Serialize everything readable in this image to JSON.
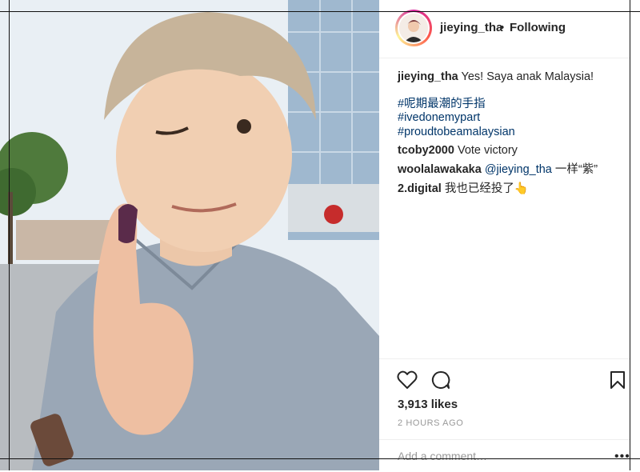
{
  "header": {
    "username": "jieying_tha",
    "separator": "•",
    "follow_status": "Following"
  },
  "caption": {
    "username": "jieying_tha",
    "text": "Yes! Saya anak Malaysia!",
    "hashtags": [
      "#呢期最潮的手指",
      "#ivedonemypart",
      "#proudtobeamalaysian"
    ]
  },
  "comments": [
    {
      "username": "tcoby2000",
      "text": "Vote victory"
    },
    {
      "username": "woolalawakaka",
      "mention": "@jieying_tha",
      "text": "一样“紫”"
    },
    {
      "username": "2.digital",
      "text": "我也已经投了👆"
    }
  ],
  "actions": {
    "like_icon": "heart-icon",
    "comment_icon": "comment-bubble-icon",
    "save_icon": "bookmark-icon"
  },
  "likes": "3,913 likes",
  "timestamp": "2 HOURS AGO",
  "comment_box": {
    "placeholder": "Add a comment…",
    "more_label": "•••"
  },
  "colors": {
    "hashtag": "#003569",
    "text": "#262626",
    "muted": "#999999",
    "avatar_ring": "#d6249f"
  }
}
